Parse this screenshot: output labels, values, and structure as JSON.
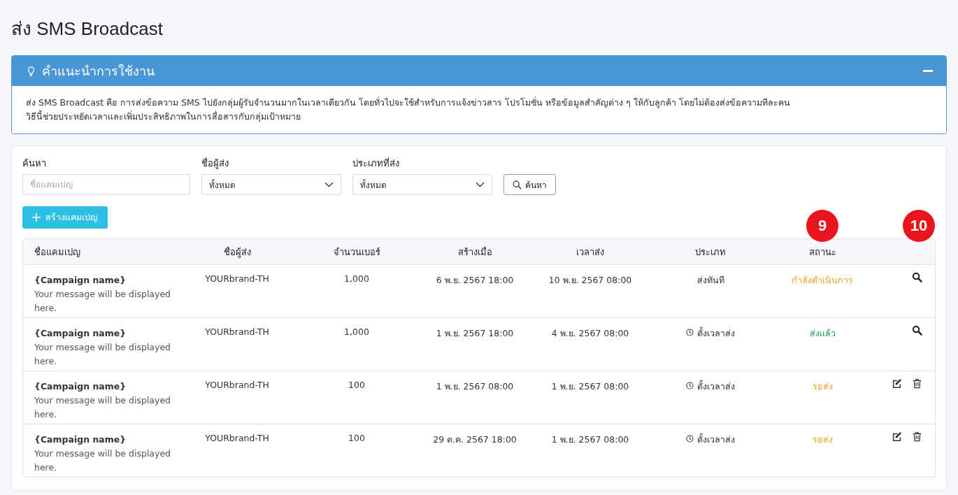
{
  "page_title": "ส่ง SMS Broadcast",
  "guide": {
    "title": "คำแนะนำการใช้งาน",
    "expanded": true,
    "lines": [
      "ส่ง SMS Broadcast คือ การส่งข้อความ SMS ไปยังกลุ่มผู้รับจำนวนมากในเวลาเดียวกัน โดยทั่วไปจะใช้สำหรับการแจ้งข่าวสาร โปรโมชั่น หรือข้อมูลสำคัญต่าง ๆ ให้กับลูกค้า โดยไม่ต้องส่งข้อความทีละคน",
      "วิธีนี้ช่วยประหยัดเวลาและเพิ่มประสิทธิภาพในการสื่อสารกับกลุ่มเป้าหมาย"
    ]
  },
  "filters": {
    "search": {
      "label": "ค้นหา",
      "placeholder": "ชื่อแคมเปญ"
    },
    "sender": {
      "label": "ชื่อผู้ส่ง",
      "value": "ทั้งหมด"
    },
    "type": {
      "label": "ประเภทที่ส่ง",
      "value": "ทั้งหมด"
    },
    "search_button": "ค้นหา"
  },
  "create_button": "สร้างแคมเปญ",
  "table": {
    "columns": [
      {
        "label": "ชื่อแคมเปญ"
      },
      {
        "label": "ชื่อผู้ส่ง"
      },
      {
        "label": "จำนวนเบอร์"
      },
      {
        "label": "สร้างเมื่อ"
      },
      {
        "label": "เวลาส่ง"
      },
      {
        "label": "ประเภท"
      },
      {
        "label": "สถานะ",
        "badge": "9"
      },
      {
        "badge": "10"
      }
    ],
    "rows": [
      {
        "name": "{Campaign name}",
        "message": "Your message will be displayed here.",
        "sender": "YOURbrand-TH",
        "count": "1,000",
        "created": "6 พ.ย. 2567 18:00",
        "send_time": "10 พ.ย. 2567 08:00",
        "type": {
          "kind": "instant",
          "text": "ส่งทันที"
        },
        "status": {
          "text": "กำลังดำเนินการ",
          "color": "#f0a020"
        },
        "actions": [
          {
            "kind": "view"
          }
        ]
      },
      {
        "name": "{Campaign name}",
        "message": "Your message will be displayed here.",
        "sender": "YOURbrand-TH",
        "count": "1,000",
        "created": "1 พ.ย. 2567 18:00",
        "send_time": "4 พ.ย. 2567 08:00",
        "type": {
          "kind": "scheduled",
          "text": "ตั้งเวลาส่ง"
        },
        "status": {
          "text": "ส่งแล้ว",
          "color": "#1e9e50"
        },
        "actions": [
          {
            "kind": "view"
          }
        ]
      },
      {
        "name": "{Campaign name}",
        "message": "Your message will be displayed here.",
        "sender": "YOURbrand-TH",
        "count": "100",
        "created": "1 พ.ย. 2567 08:00",
        "send_time": "1 พ.ย. 2567 08:00",
        "type": {
          "kind": "scheduled",
          "text": "ตั้งเวลาส่ง"
        },
        "status": {
          "text": "รอส่ง",
          "color": "#f0a020"
        },
        "actions": [
          {
            "kind": "edit"
          },
          {
            "kind": "delete"
          }
        ]
      },
      {
        "name": "{Campaign name}",
        "message": "Your message will be displayed here.",
        "sender": "YOURbrand-TH",
        "count": "100",
        "created": "29 ต.ค. 2567 18:00",
        "send_time": "1 พ.ย. 2567 08:00",
        "type": {
          "kind": "scheduled",
          "text": "ตั้งเวลาส่ง"
        },
        "status": {
          "text": "รอส่ง",
          "color": "#f0a020"
        },
        "actions": [
          {
            "kind": "edit"
          },
          {
            "kind": "delete"
          }
        ]
      }
    ]
  }
}
